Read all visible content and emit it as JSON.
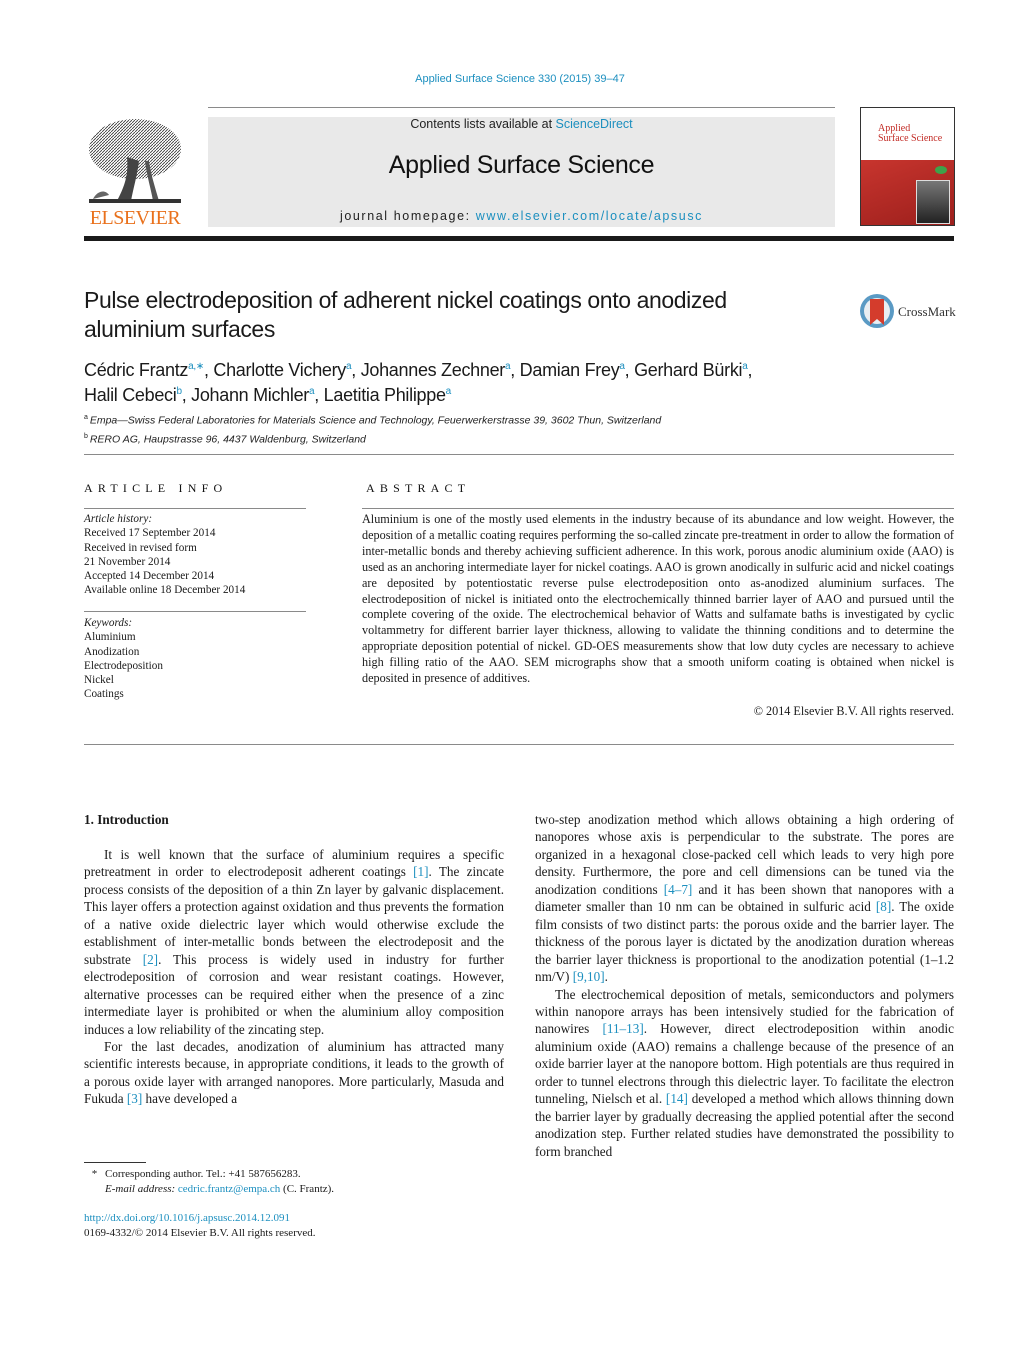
{
  "header": {
    "journal_reference": "Applied Surface Science 330 (2015) 39–47",
    "contents_prefix": "Contents lists available at ",
    "contents_link": "ScienceDirect",
    "journal_title": "Applied Surface Science",
    "homepage_prefix": "journal homepage: ",
    "homepage_link": "www.elsevier.com/locate/apsusc",
    "publisher_logo_text": "ELSEVIER",
    "cover_title_line1": "Applied",
    "cover_title_line2": "Surface Science",
    "colors": {
      "link": "#1c8fbf",
      "elsevier_orange": "#e9711c",
      "cover_red": "#c22a24",
      "masthead_bg": "#e9e9e9"
    }
  },
  "article": {
    "title": "Pulse electrodeposition of adherent nickel coatings onto anodized aluminium surfaces",
    "crossmark_label": "CrossMark",
    "authors": [
      {
        "name": "Cédric Frantz",
        "aff": "a,∗",
        "sep": ", "
      },
      {
        "name": "Charlotte Vichery",
        "aff": "a",
        "sep": ", "
      },
      {
        "name": "Johannes Zechner",
        "aff": "a",
        "sep": ", "
      },
      {
        "name": "Damian Frey",
        "aff": "a",
        "sep": ", "
      },
      {
        "name": "Gerhard Bürki",
        "aff": "a",
        "sep": ","
      },
      {
        "name": "Halil Cebeci",
        "aff": "b",
        "sep": ", "
      },
      {
        "name": "Johann Michler",
        "aff": "a",
        "sep": ", "
      },
      {
        "name": "Laetitia Philippe",
        "aff": "a",
        "sep": ""
      }
    ],
    "affiliations": [
      {
        "key": "a",
        "text": "Empa—Swiss Federal Laboratories for Materials Science and Technology, Feuerwerkerstrasse 39, 3602 Thun, Switzerland"
      },
      {
        "key": "b",
        "text": "RERO AG, Haupstrasse 96, 4437 Waldenburg, Switzerland"
      }
    ]
  },
  "article_info": {
    "heading": "ARTICLE INFO",
    "history_label": "Article history:",
    "history": [
      "Received 17 September 2014",
      "Received in revised form",
      "21 November 2014",
      "Accepted 14 December 2014",
      "Available online 18 December 2014"
    ],
    "keywords_label": "Keywords:",
    "keywords": [
      "Aluminium",
      "Anodization",
      "Electrodeposition",
      "Nickel",
      "Coatings"
    ]
  },
  "abstract": {
    "heading": "ABSTRACT",
    "text": "Aluminium is one of the mostly used elements in the industry because of its abundance and low weight. However, the deposition of a metallic coating requires performing the so-called zincate pre-treatment in order to allow the formation of inter-metallic bonds and thereby achieving sufficient adherence. In this work, porous anodic aluminium oxide (AAO) is used as an anchoring intermediate layer for nickel coatings. AAO is grown anodically in sulfuric acid and nickel coatings are deposited by potentiostatic reverse pulse electrodeposition onto as-anodized aluminium surfaces. The electrodeposition of nickel is initiated onto the electrochemically thinned barrier layer of AAO and pursued until the complete covering of the oxide. The electrochemical behavior of Watts and sulfamate baths is investigated by cyclic voltammetry for different barrier layer thickness, allowing to validate the thinning conditions and to determine the appropriate deposition potential of nickel. GD-OES measurements show that low duty cycles are necessary to achieve high filling ratio of the AAO. SEM micrographs show that a smooth uniform coating is obtained when nickel is deposited in presence of additives.",
    "copyright": "© 2014 Elsevier B.V. All rights reserved."
  },
  "body": {
    "section_heading": "1.  Introduction",
    "left_paragraphs": [
      [
        {
          "t": "It is well known that the surface of aluminium requires a specific pretreatment in order to electrodeposit adherent coatings "
        },
        {
          "c": "[1]"
        },
        {
          "t": ". The zincate process consists of the deposition of a thin Zn layer by galvanic displacement. This layer offers a protection against oxidation and thus prevents the formation of a native oxide dielectric layer which would otherwise exclude the establishment of inter-metallic bonds between the electrodeposit and the substrate "
        },
        {
          "c": "[2]"
        },
        {
          "t": ". This process is widely used in industry for further electrodeposition of corrosion and wear resistant coatings. However, alternative processes can be required either when the presence of a zinc intermediate layer is prohibited or when the aluminium alloy composition induces a low reliability of the zincating step."
        }
      ],
      [
        {
          "t": "For the last decades, anodization of aluminium has attracted many scientific interests because, in appropriate conditions, it leads to the growth of a porous oxide layer with arranged nanopores. More particularly, Masuda and Fukuda "
        },
        {
          "c": "[3]"
        },
        {
          "t": " have developed a"
        }
      ]
    ],
    "right_paragraphs": [
      [
        {
          "t": "two-step anodization method which allows obtaining a high ordering of nanopores whose axis is perpendicular to the substrate. The pores are organized in a hexagonal close-packed cell which leads to very high pore density. Furthermore, the pore and cell dimensions can be tuned via the anodization conditions "
        },
        {
          "c": "[4–7]"
        },
        {
          "t": " and it has been shown that nanopores with a diameter smaller than 10 nm can be obtained in sulfuric acid "
        },
        {
          "c": "[8]"
        },
        {
          "t": ". The oxide film consists of two distinct parts: the porous oxide and the barrier layer. The thickness of the porous layer is dictated by the anodization duration whereas the barrier layer thickness is proportional to the anodization potential (1–1.2 nm/V) "
        },
        {
          "c": "[9,10]"
        },
        {
          "t": "."
        }
      ],
      [
        {
          "t": "The electrochemical deposition of metals, semiconductors and polymers within nanopore arrays has been intensively studied for the fabrication of nanowires "
        },
        {
          "c": "[11–13]"
        },
        {
          "t": ". However, direct electrodeposition within anodic aluminium oxide (AAO) remains a challenge because of the presence of an oxide barrier layer at the nanopore bottom. High potentials are thus required in order to tunnel electrons through this dielectric layer. To facilitate the electron tunneling, Nielsch et al. "
        },
        {
          "c": "[14]"
        },
        {
          "t": " developed a method which allows thinning down the barrier layer by gradually decreasing the applied potential after the second anodization step. Further related studies have demonstrated the possibility to form branched"
        }
      ]
    ]
  },
  "footer": {
    "footnote_star": "*",
    "footnote_line1": "Corresponding author. Tel.: +41 587656283.",
    "email_label": "E-mail address: ",
    "email": "cedric.frantz@empa.ch",
    "email_suffix": " (C. Frantz).",
    "doi_link": "http://dx.doi.org/10.1016/j.apsusc.2014.12.091",
    "issn_line": "0169-4332/© 2014 Elsevier B.V. All rights reserved."
  }
}
